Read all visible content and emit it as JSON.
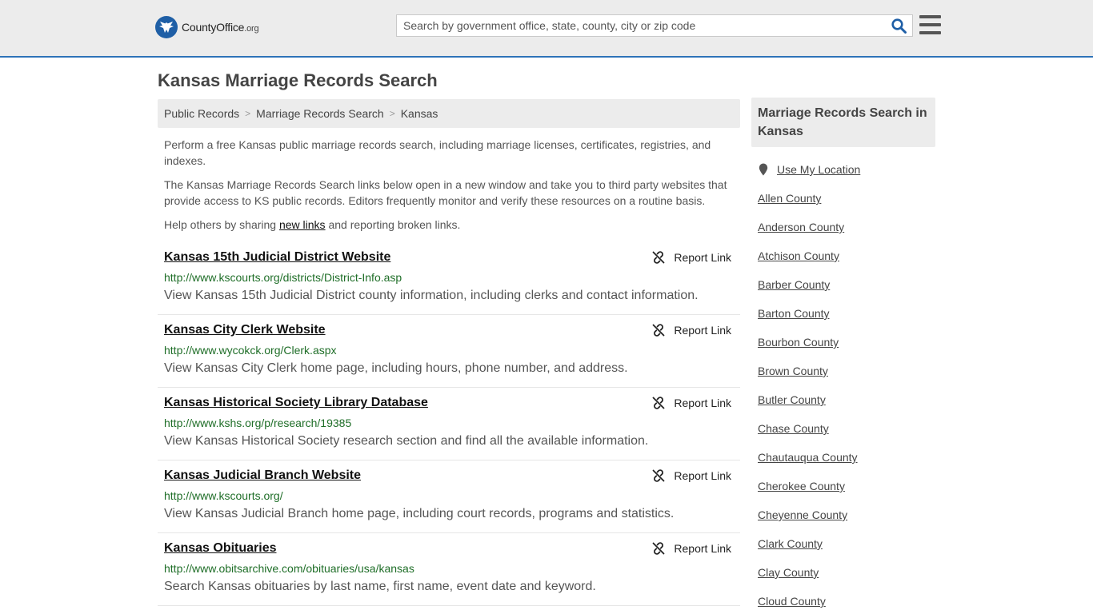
{
  "header": {
    "logo_main": "CountyOffice",
    "logo_suffix": ".org",
    "search_placeholder": "Search by government office, state, county, city or zip code"
  },
  "page_title": "Kansas Marriage Records Search",
  "breadcrumb": [
    "Public Records",
    "Marriage Records Search",
    "Kansas"
  ],
  "breadcrumb_sep": ">",
  "intro": {
    "p1": "Perform a free Kansas public marriage records search, including marriage licenses, certificates, registries, and indexes.",
    "p2": "The Kansas Marriage Records Search links below open in a new window and take you to third party websites that provide access to KS public records. Editors frequently monitor and verify these resources on a routine basis.",
    "p3_before": "Help others by sharing ",
    "p3_link": "new links",
    "p3_after": " and reporting broken links."
  },
  "report_label": "Report Link",
  "results": [
    {
      "title": "Kansas 15th Judicial District Website",
      "url": "http://www.kscourts.org/districts/District-Info.asp",
      "desc": "View Kansas 15th Judicial District county information, including clerks and contact information."
    },
    {
      "title": "Kansas City Clerk Website",
      "url": "http://www.wycokck.org/Clerk.aspx",
      "desc": "View Kansas City Clerk home page, including hours, phone number, and address."
    },
    {
      "title": "Kansas Historical Society Library Database",
      "url": "http://www.kshs.org/p/research/19385",
      "desc": "View Kansas Historical Society research section and find all the available information."
    },
    {
      "title": "Kansas Judicial Branch Website",
      "url": "http://www.kscourts.org/",
      "desc": "View Kansas Judicial Branch home page, including court records, programs and statistics."
    },
    {
      "title": "Kansas Obituaries",
      "url": "http://www.obitsarchive.com/obituaries/usa/kansas",
      "desc": "Search Kansas obituaries by last name, first name, event date and keyword."
    }
  ],
  "sidebar": {
    "heading": "Marriage Records Search in Kansas",
    "use_location": "Use My Location",
    "counties": [
      "Allen County",
      "Anderson County",
      "Atchison County",
      "Barber County",
      "Barton County",
      "Bourbon County",
      "Brown County",
      "Butler County",
      "Chase County",
      "Chautauqua County",
      "Cherokee County",
      "Cheyenne County",
      "Clark County",
      "Clay County",
      "Cloud County"
    ]
  },
  "colors": {
    "accent": "#2e73b8",
    "url_green": "#1f6e28",
    "search_icon": "#1f5fa6"
  }
}
